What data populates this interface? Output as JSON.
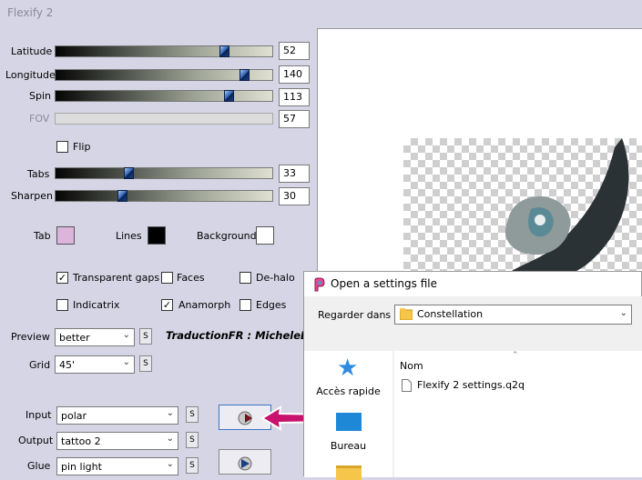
{
  "window": {
    "title": "Flexify 2"
  },
  "sliders": {
    "latitude": {
      "label": "Latitude",
      "value": "52"
    },
    "longitude": {
      "label": "Longitude",
      "value": "140"
    },
    "spin": {
      "label": "Spin",
      "value": "113"
    },
    "fov": {
      "label": "FOV",
      "value": "57"
    },
    "tabs": {
      "label": "Tabs",
      "value": "33"
    },
    "sharpen": {
      "label": "Sharpen",
      "value": "30"
    }
  },
  "flip": {
    "label": "Flip",
    "checked": false
  },
  "colors": {
    "tab": {
      "label": "Tab",
      "color": "#dcb4dc"
    },
    "lines": {
      "label": "Lines",
      "color": "#000000"
    },
    "background": {
      "label": "Background",
      "color": "#ffffff"
    }
  },
  "options": {
    "transparent_gaps": {
      "label": "Transparent gaps",
      "checked": true
    },
    "faces": {
      "label": "Faces",
      "checked": false
    },
    "de_halo": {
      "label": "De-halo",
      "checked": false
    },
    "indicatrix": {
      "label": "Indicatrix",
      "checked": false
    },
    "anamorph": {
      "label": "Anamorph",
      "checked": true
    },
    "edges": {
      "label": "Edges",
      "checked": false
    }
  },
  "preview": {
    "label": "Preview",
    "value": "better"
  },
  "grid": {
    "label": "Grid",
    "value": "45'"
  },
  "input": {
    "label": "Input",
    "value": "polar"
  },
  "output": {
    "label": "Output",
    "value": "tattoo 2"
  },
  "glue": {
    "label": "Glue",
    "value": "pin light"
  },
  "s_button_label": "S",
  "watermark": "TraductionFR : MicheleB-Graphisme",
  "dialog": {
    "title": "Open a settings file",
    "look_in_label": "Regarder dans :",
    "look_in_value": "Constellation",
    "column_name": "Nom",
    "places": [
      {
        "label": "Accès rapide",
        "icon": "star-icon"
      },
      {
        "label": "Bureau",
        "icon": "desktop-icon"
      },
      {
        "label": "",
        "icon": "libraries-icon"
      }
    ],
    "files": [
      {
        "name": "Flexify 2 settings.q2q",
        "icon": "file-icon"
      }
    ]
  },
  "accent_colors": {
    "arrow": "#c8126e",
    "thumb": "#2a5cb0",
    "folder": "#f5c64a"
  }
}
